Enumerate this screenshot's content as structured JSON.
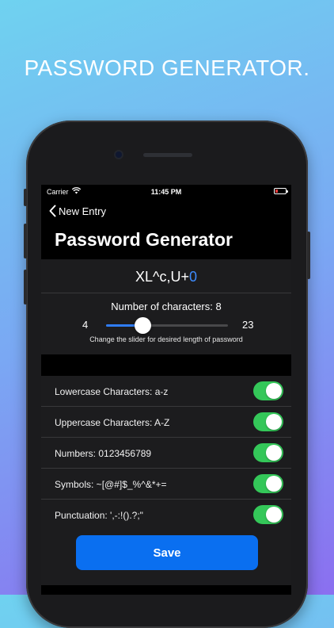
{
  "headline": "PASSWORD GENERATOR.",
  "status_bar": {
    "carrier": "Carrier",
    "time": "11:45 PM"
  },
  "nav": {
    "back_label": "New Entry"
  },
  "page_title": "Password Generator",
  "generated_password": {
    "main": "XL^c,U+",
    "last_char": "0",
    "last_char_color": "#3d8bfd"
  },
  "slider": {
    "label": "Number of characters: 8",
    "min_label": "4",
    "max_label": "23",
    "min": 4,
    "max": 23,
    "value": 8,
    "hint": "Change the slider for desired length of password",
    "fill_color": "#2f7cf6"
  },
  "options": [
    {
      "label": "Lowercase Characters: a-z",
      "enabled": true
    },
    {
      "label": "Uppercase Characters: A-Z",
      "enabled": true
    },
    {
      "label": "Numbers: 0123456789",
      "enabled": true
    },
    {
      "label": "Symbols: ~[@#]$_%^&*+=",
      "enabled": true
    },
    {
      "label": "Punctuation: ',-:!().?;\"",
      "enabled": true
    }
  ],
  "toggle_on_color": "#34c759",
  "save_label": "Save",
  "save_color": "#0a6ff0"
}
